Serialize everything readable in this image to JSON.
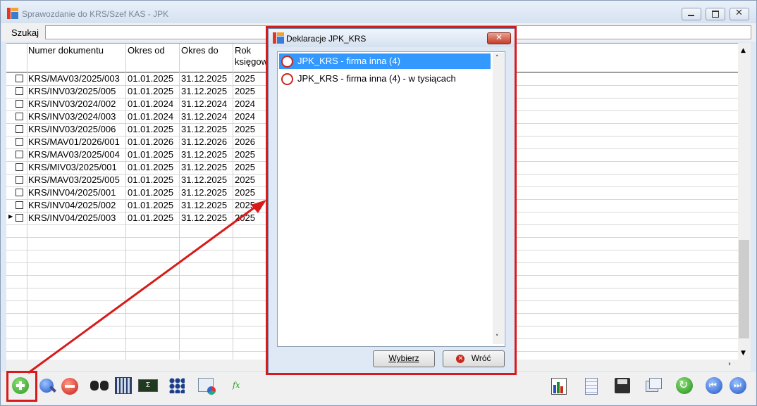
{
  "window": {
    "title": "Sprawozdanie do KRS/Szef KAS - JPK"
  },
  "search": {
    "label": "Szukaj",
    "value": ""
  },
  "grid": {
    "columns": [
      "Numer dokumentu",
      "Okres od",
      "Okres do",
      "Rok\nksięgow"
    ],
    "rows": [
      [
        "KRS/MAV03/2025/003",
        "01.01.2025",
        "31.12.2025",
        "2025"
      ],
      [
        "KRS/INV03/2025/005",
        "01.01.2025",
        "31.12.2025",
        "2025"
      ],
      [
        "KRS/INV03/2024/002",
        "01.01.2024",
        "31.12.2024",
        "2024"
      ],
      [
        "KRS/INV03/2024/003",
        "01.01.2024",
        "31.12.2024",
        "2024"
      ],
      [
        "KRS/INV03/2025/006",
        "01.01.2025",
        "31.12.2025",
        "2025"
      ],
      [
        "KRS/MAV01/2026/001",
        "01.01.2026",
        "31.12.2026",
        "2026"
      ],
      [
        "KRS/MAV03/2025/004",
        "01.01.2025",
        "31.12.2025",
        "2025"
      ],
      [
        "KRS/MIV03/2025/001",
        "01.01.2025",
        "31.12.2025",
        "2025"
      ],
      [
        "KRS/MAV03/2025/005",
        "01.01.2025",
        "31.12.2025",
        "2025"
      ],
      [
        "KRS/INV04/2025/001",
        "01.01.2025",
        "31.12.2025",
        "2025"
      ],
      [
        "KRS/INV04/2025/002",
        "01.01.2025",
        "31.12.2025",
        "2025"
      ],
      [
        "KRS/INV04/2025/003",
        "01.01.2025",
        "31.12.2025",
        "2025"
      ]
    ]
  },
  "dialog": {
    "title": "Deklaracje JPK_KRS",
    "items": [
      {
        "label": "JPK_KRS - firma inna (4)",
        "selected": true
      },
      {
        "label": "JPK_KRS - firma inna (4) - w tysiącach",
        "selected": false
      }
    ],
    "select_button": "Wybierz",
    "back_button": "Wróć"
  },
  "toolbar": {
    "left_icons": [
      "add-icon",
      "edit-icon",
      "delete-icon",
      "binoculars-icon",
      "calendar-icon",
      "formula-icon",
      "tree-icon",
      "window-chart-icon",
      "fx-icon"
    ],
    "right_icons": [
      "report-chart-icon",
      "document-icon",
      "save-icon",
      "windows-icon",
      "refresh-icon",
      "first-page-icon",
      "next-page-icon"
    ]
  },
  "colors": {
    "highlight": "#d81a1a",
    "selection": "#3399ff"
  }
}
